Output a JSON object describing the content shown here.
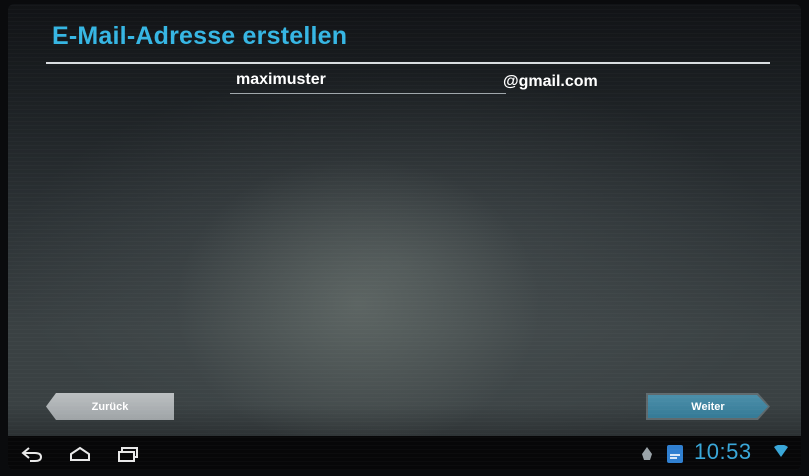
{
  "header": {
    "title": "E-Mail-Adresse erstellen"
  },
  "form": {
    "username_value": "maximuster",
    "domain_suffix": "@gmail.com"
  },
  "buttons": {
    "back_label": "Zurück",
    "next_label": "Weiter"
  },
  "system_bar": {
    "time": "10:53"
  },
  "colors": {
    "accent": "#36b6e3",
    "clock": "#3aa7d8",
    "button_active": "#357a96"
  },
  "icons": [
    "back-nav-icon",
    "home-nav-icon",
    "recent-apps-nav-icon",
    "android-notification-icon",
    "app-notification-icon",
    "wifi-icon"
  ]
}
